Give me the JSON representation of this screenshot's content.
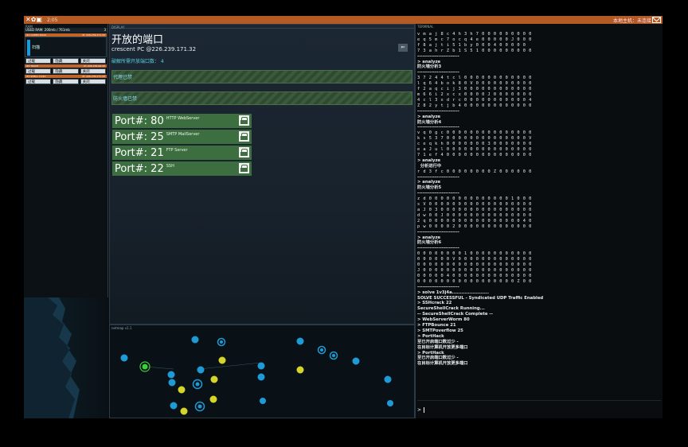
{
  "topbar": {
    "icons": "✕✿▣",
    "time": "2:05",
    "host": "本地主机：未连接"
  },
  "ram": {
    "header": "RAM",
    "sub_left": "USED RAM: 200mb / 761mb",
    "sub_right": "3",
    "proc1": {
      "hdr_left": "#1 CLIENT-HACK",
      "hdr_right": "IP: 226.239.171.32",
      "label": "扫描",
      "buttons": [
        "过载",
        "隐藏",
        "关闭"
      ]
    },
    "proc2": {
      "hdr_left": "#2 TRACE",
      "hdr_right": "IP: 226.239.96.42",
      "buttons": [
        "过载",
        "隐藏",
        "关闭"
      ]
    },
    "proc3": {
      "hdr_left": "#3 SHELL 0.224",
      "hdr_right": "IP: 226.239.171.32",
      "buttons": [
        "过载",
        "隐藏",
        "关闭"
      ]
    }
  },
  "display": {
    "header": "DISPLAY",
    "title": "开放的端口",
    "subtitle": "crescent PC @226.239.171.32",
    "count": "破解所需开放端口数： 4",
    "back": "⇐",
    "stripe1": "代理已禁",
    "stripe2": "防火墙已禁",
    "ports": [
      {
        "num": "Port#: 80",
        "svc": "HTTP WebServer"
      },
      {
        "num": "Port#: 25",
        "svc": "SMTP MailServer"
      },
      {
        "num": "Port#: 21",
        "svc": "FTP Server"
      },
      {
        "num": "Port#: 22",
        "svc": "SSH"
      }
    ]
  },
  "netmap": {
    "header": "netmap v1.1"
  },
  "terminal": {
    "header": "TERMINAL",
    "lines": [
      "v m a j 8 c 4 h 3 h 7 0 0 0 0 0 0 0 0 0",
      "e q 5 m c 7 o c q 4 e 0 0 0 0 0 J 0 0 0",
      "f 8 a j t i 5 1 b y 0 0 0 4 0 0 0 0 0",
      "7 3 a h r Z b 1 S 5 1 0 0 0 0 0 0 0 0 0",
      "------------------------",
      "> analyze",
      "防火墙分析3",
      "------------------------",
      "3 7 2 4 4 t c l 0 0 0 0 0 0 0 0 0 0 0 0",
      "l q 6 4 b o k 8 0 V 0 0 0 0 0 0 0 0 0 0",
      "f 2 a q c i j 3 0 0 0 0 0 0 0 0 0 0 0 0",
      "m 6 6 i 2 x c x 0 0 0 0 J 0 0 0 0 0 0 0",
      "4 c l 3 x d r c 0 0 0 0 0 0 0 0 0 0 0 4",
      "Z 8 2 y t j b 4 0 0 0 0 0 0 0 0 0 0 0 0",
      "------------------------",
      "> analyze",
      "防火墙分析4",
      "------------------------",
      "v q 0 g c 0 0 0 0 0 0 0 0 0 0 0 0 0 0 0",
      "k s 5 3 7 0 0 0 0 0 0 0 0 0 0 0 0 0 0 V",
      "c e q k h 0 0 0 0 0 0 0 3 0 0 0 0 0 0 0",
      "e a J u l 0 0 0 0 0 0 0 0 0 0 0 0 0 0 0",
      "7 1 e f 4 0 0 0 0 0 0 0 0 0 0 0 0 0 0 0",
      "> analyze",
      "  分析进行中",
      "r d 3 f c 0 0 0 0 0 0 0 0 Z 0 0 0 0 0 0",
      "------------------------",
      "> analyze",
      "防火墙分析5",
      "------------------------",
      "z d 0 0 0 0 0 0 0 0 0 0 0 0 0 0 1 0 0 0",
      "s V 0 0 0 0 0 0 0 0 0 0 0 0 0 0 0 0 0 0",
      "a J 0 3 0 0 0 0 0 0 0 0 0 0 0 0 0 0 0 0",
      "d w 0 0 J 0 0 0 0 0 0 0 0 0 0 0 0 0 0 0",
      "2 q 0 0 0 0 0 0 0 0 0 0 0 0 0 0 0 0 4 0",
      "p w 0 0 0 0 2 0 0 0 0 0 0 0 0 0 0 0 0 0",
      "------------------------",
      "> analyze",
      "防火墙分析6",
      "------------------------",
      "0 0 0 0 0 0 0 0 1 0 0 0 0 0 0 0 0 0 0 0",
      "0 0 0 0 0 0 V 0 0 0 0 0 0 0 0 0 0 0 0 0",
      "0 0 0 0 0 0 0 0 0 0 0 0 0 0 0 0 0 0 0 0",
      "J 0 0 0 0 0 0 0 0 0 0 0 0 0 0 0 0 0 0 0",
      "0 0 0 0 0 4 0 0 0 0 0 0 0 0 0 0 0 0 0 0",
      "0 0 0 0 0 0 0 0 0 0 0 0 0 0 0 0 0 Z 0 0",
      "------------------------",
      "> solve 1v3j4a.......................",
      "SOLVE SUCCESSFUL - Syndicated UDP Traffic Enabled",
      "> SSHcrack 22",
      "SecureShellCrack Running...",
      "-- SecureShellCrack Complete --",
      "> WebServerWorm 80",
      "> FTPBounce 21",
      "> SMTPoverflow 25",
      "> PortHack",
      "至已开启端口数过少 -",
      "在目标计算机开放更多端口",
      "> PortHack",
      "至已开启端口数过少 -",
      "在目标计算机开放更多端口"
    ],
    "prompt": ">"
  },
  "colors": {
    "accent": "#b45a24",
    "port_green": "#3d6e3f",
    "node_blue": "#1e9bd7",
    "node_yellow": "#d4d42a",
    "node_green": "#3bd13b"
  }
}
